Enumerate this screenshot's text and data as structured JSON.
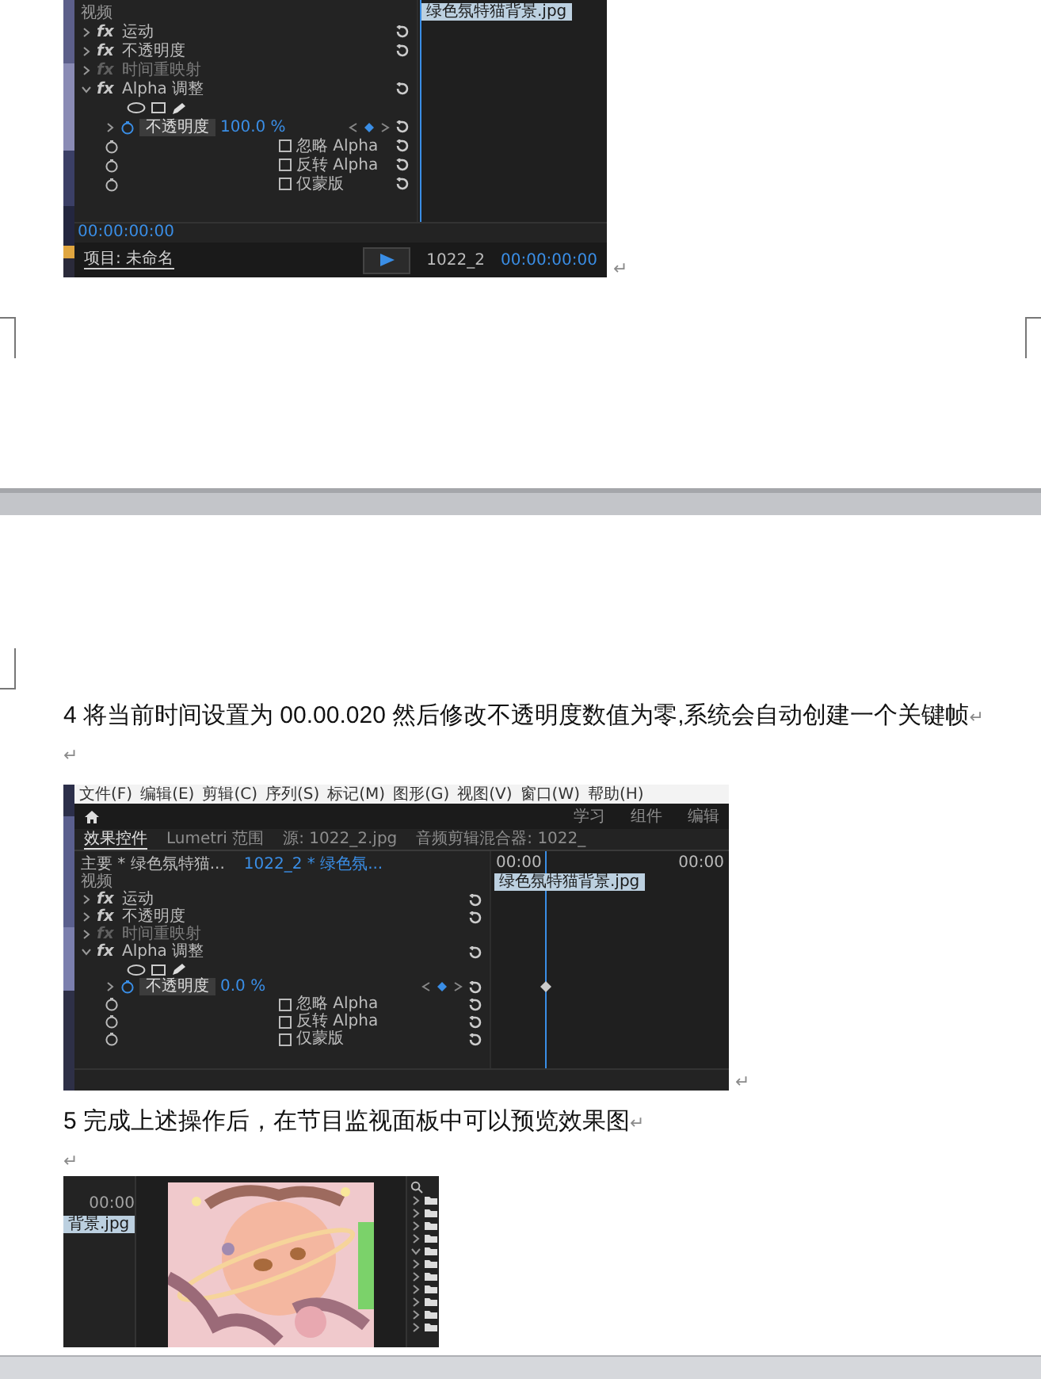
{
  "pages": [
    {
      "blocks": [
        {
          "kind": "effects_window",
          "return_mark": "↵",
          "effects": [
            {
              "kind": "section",
              "label": "视频"
            },
            {
              "kind": "fx",
              "badge": "fx",
              "label": "运动",
              "expanded": false,
              "enabled": true
            },
            {
              "kind": "fx",
              "badge": "fx",
              "label": "不透明度",
              "expanded": false,
              "enabled": true
            },
            {
              "kind": "fx",
              "badge": "fx",
              "label": "时间重映射",
              "expanded": false,
              "enabled": false
            },
            {
              "kind": "fx",
              "badge": "fx",
              "label": "Alpha 调整",
              "expanded": true,
              "enabled": true
            },
            {
              "kind": "masks"
            },
            {
              "kind": "param",
              "label": "不透明度",
              "value": "100.0 %",
              "expanded": false,
              "keyframe": false
            },
            {
              "kind": "checkbox",
              "label": "忽略 Alpha",
              "checked": false
            },
            {
              "kind": "checkbox",
              "label": "反转 Alpha",
              "checked": false
            },
            {
              "kind": "checkbox",
              "label": "仅蒙版",
              "checked": false
            }
          ],
          "clip": "绿色氛特猫背景.jpg",
          "timecode": "00:00:00:00",
          "bottom_bar": {
            "project_tab": "项目: 未命名",
            "sequence": "1022_2",
            "timecode": "00:00:00:00"
          }
        }
      ]
    },
    {
      "blocks": [
        {
          "kind": "paragraph",
          "text": "4 将当前时间设置为 00.00.020 然后修改不透明度数值为零,系统会自动创建一个关键帧",
          "return_mark": "↵"
        },
        {
          "kind": "empty_line",
          "return_mark": "↵"
        },
        {
          "kind": "effects_window",
          "return_mark": "↵",
          "menu": [
            "文件(F)",
            "编辑(E)",
            "剪辑(C)",
            "序列(S)",
            "标记(M)",
            "图形(G)",
            "视图(V)",
            "窗口(W)",
            "帮助(H)"
          ],
          "workspaces": [
            "学习",
            "组件",
            "编辑"
          ],
          "tabs": [
            {
              "label": "效果控件",
              "selected": true
            },
            {
              "label": "Lumetri 范围",
              "selected": false
            },
            {
              "label": "源: 1022_2.jpg",
              "selected": false
            },
            {
              "label": "音频剪辑混合器: 1022_",
              "selected": false
            }
          ],
          "sequence": {
            "master": "主要 * 绿色氛特猫...",
            "clip": "1022_2 * 绿色氛..."
          },
          "ruler": [
            "00:00",
            "00:00"
          ],
          "effects": [
            {
              "kind": "section",
              "label": "视频"
            },
            {
              "kind": "fx",
              "badge": "fx",
              "label": "运动",
              "expanded": false,
              "enabled": true
            },
            {
              "kind": "fx",
              "badge": "fx",
              "label": "不透明度",
              "expanded": false,
              "enabled": true
            },
            {
              "kind": "fx",
              "badge": "fx",
              "label": "时间重映射",
              "expanded": false,
              "enabled": false
            },
            {
              "kind": "fx",
              "badge": "fx",
              "label": "Alpha 调整",
              "expanded": true,
              "enabled": true
            },
            {
              "kind": "masks"
            },
            {
              "kind": "param",
              "label": "不透明度",
              "value": "0.0 %",
              "expanded": false,
              "keyframe": true
            },
            {
              "kind": "checkbox",
              "label": "忽略 Alpha",
              "checked": false
            },
            {
              "kind": "checkbox",
              "label": "反转 Alpha",
              "checked": false
            },
            {
              "kind": "checkbox",
              "label": "仅蒙版",
              "checked": false
            }
          ],
          "clip": "绿色氛特猫背景.jpg"
        },
        {
          "kind": "paragraph",
          "text": "5 完成上述操作后，在节目监视面板中可以预览效果图",
          "return_mark": "↵"
        },
        {
          "kind": "empty_line",
          "return_mark": "↵"
        },
        {
          "kind": "monitor_window",
          "timecode": "00:00",
          "clip": "背景.jpg",
          "folders": [
            {
              "expanded": false
            },
            {
              "expanded": false
            },
            {
              "expanded": false
            },
            {
              "expanded": false
            },
            {
              "expanded": true
            },
            {
              "expanded": false
            },
            {
              "expanded": false
            },
            {
              "expanded": false
            },
            {
              "expanded": false
            },
            {
              "expanded": false
            },
            {
              "expanded": false
            }
          ]
        }
      ]
    }
  ]
}
